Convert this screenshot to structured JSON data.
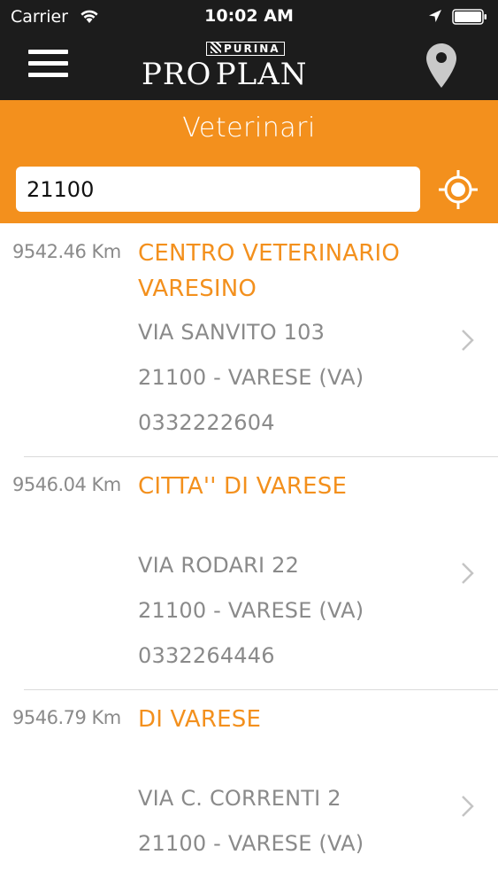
{
  "status_bar": {
    "carrier": "Carrier",
    "time": "10:02 AM"
  },
  "brand": {
    "purina": "PURINA",
    "logo_pro": "PRO",
    "logo_plan": "PLAN"
  },
  "header": {
    "title": "Veterinari"
  },
  "search": {
    "value": "21100"
  },
  "colors": {
    "accent": "#f3901d",
    "dark": "#1c1c1c",
    "muted": "#8a8a8a"
  },
  "results": [
    {
      "distance": "9542.46 Km",
      "name": "CENTRO VETERINARIO VARESINO",
      "address": "VIA SANVITO 103",
      "city": "21100 - VARESE (VA)",
      "phone": "0332222604"
    },
    {
      "distance": "9546.04 Km",
      "name": "CITTA'' DI VARESE",
      "address": "VIA RODARI 22",
      "city": "21100 - VARESE (VA)",
      "phone": "0332264446"
    },
    {
      "distance": "9546.79 Km",
      "name": "DI VARESE",
      "address": "VIA C. CORRENTI 2",
      "city": "21100 - VARESE (VA)",
      "phone": ""
    }
  ]
}
